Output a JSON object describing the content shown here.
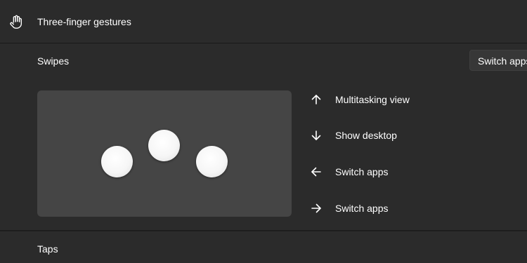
{
  "header": {
    "icon": "hand-icon",
    "title": "Three-finger gestures"
  },
  "swipes": {
    "label": "Swipes",
    "dropdown_value": "Switch apps",
    "gestures": [
      {
        "direction": "up",
        "icon": "arrow-up-icon",
        "label": "Multitasking view"
      },
      {
        "direction": "down",
        "icon": "arrow-down-icon",
        "label": "Show desktop"
      },
      {
        "direction": "left",
        "icon": "arrow-left-icon",
        "label": "Switch apps"
      },
      {
        "direction": "right",
        "icon": "arrow-right-icon",
        "label": "Switch apps"
      }
    ]
  },
  "taps": {
    "label": "Taps"
  }
}
